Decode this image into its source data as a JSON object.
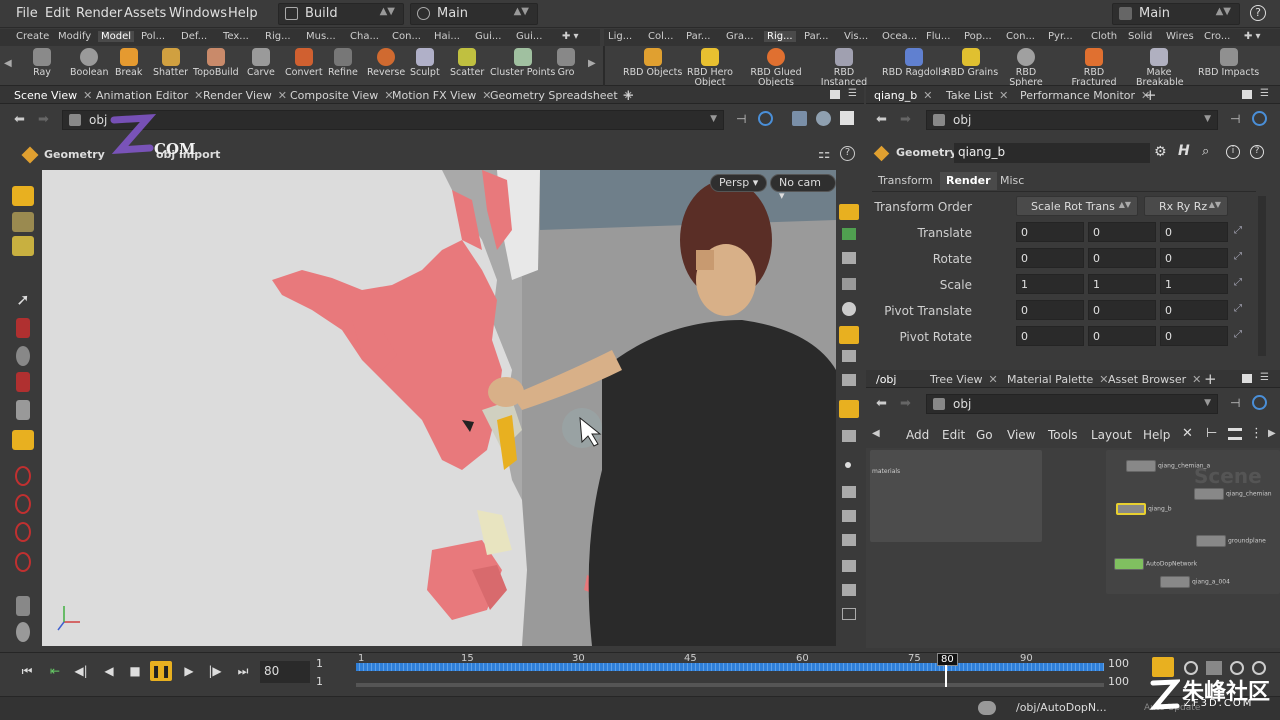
{
  "menu": {
    "items": [
      "File",
      "Edit",
      "Render",
      "Assets",
      "Windows",
      "Help"
    ],
    "desktop": "Build",
    "context": "Main",
    "main_right": "Main"
  },
  "shelf_tabs_left": [
    "Create",
    "Modify",
    "Model",
    "Pol...",
    "Def...",
    "Tex...",
    "Rig...",
    "Mus...",
    "Cha...",
    "Con...",
    "Hai...",
    "Gui...",
    "Gui..."
  ],
  "shelf_tabs_right": [
    "Lig...",
    "Col...",
    "Par...",
    "Gra...",
    "Rig...",
    "Par...",
    "Vis...",
    "Ocea...",
    "Flu...",
    "Pop...",
    "Con...",
    "Pyr...",
    "Cloth",
    "Solid",
    "Wires",
    "Cro..."
  ],
  "shelf_tools_left": [
    "Ray",
    "Boolean",
    "Break",
    "Shatter",
    "TopoBuild",
    "Carve",
    "Convert",
    "Refine",
    "Reverse",
    "Sculpt",
    "Scatter",
    "Cluster Points",
    "Gro"
  ],
  "shelf_tools_right": [
    "RBD Objects",
    "RBD Hero Object",
    "RBD Glued Objects",
    "RBD Instanced Objects",
    "RBD Ragdolls",
    "RBD Grains",
    "RBD Sphere Objects",
    "RBD Fractured Object",
    "Make Breakable",
    "RBD Impacts"
  ],
  "left_pane": {
    "tabs": [
      "Scene View",
      "Animation Editor",
      "Render View",
      "Composite View",
      "Motion FX View",
      "Geometry Spreadsheet"
    ],
    "path": "obj",
    "context_label": "Geometry",
    "node_label": "obj import",
    "persp": "Persp",
    "cam": "No cam"
  },
  "param_pane": {
    "tabs": [
      "qiang_b",
      "Take List",
      "Performance Monitor"
    ],
    "path": "obj",
    "type_label": "Geometry",
    "node_name": "qiang_b",
    "sub_tabs": [
      "Transform",
      "Render",
      "Misc"
    ],
    "active_sub_tab": "Render",
    "transform_order_label": "Transform Order",
    "transform_order": "Scale Rot Trans",
    "rot_order": "Rx Ry Rz",
    "rows": [
      {
        "label": "Translate",
        "values": [
          "0",
          "0",
          "0"
        ]
      },
      {
        "label": "Rotate",
        "values": [
          "0",
          "0",
          "0"
        ]
      },
      {
        "label": "Scale",
        "values": [
          "1",
          "1",
          "1"
        ]
      },
      {
        "label": "Pivot Translate",
        "values": [
          "0",
          "0",
          "0"
        ]
      },
      {
        "label": "Pivot Rotate",
        "values": [
          "0",
          "0",
          "0"
        ]
      }
    ]
  },
  "network_pane": {
    "tabs": [
      "/obj",
      "Tree View",
      "Material Palette",
      "Asset Browser"
    ],
    "path": "obj",
    "menu": [
      "Add",
      "Edit",
      "Go",
      "View",
      "Tools",
      "Layout",
      "Help"
    ],
    "materials_label": "materials",
    "watermark": "Scene",
    "nodes": [
      "qiang_chemian_a",
      "qiang_chemian",
      "qiang_b",
      "groundplane",
      "AutoDopNetwork",
      "qiang_a_004"
    ]
  },
  "timeline": {
    "current_frame": "80",
    "start": "1",
    "start2": "1",
    "end": "100",
    "end2": "100",
    "ticks": [
      "1",
      "15",
      "30",
      "45",
      "60",
      "75",
      "80",
      "90"
    ]
  },
  "status": {
    "path": "/obj/AutoDopN...",
    "extra": "Auto Update"
  },
  "watermark": {
    "logo_text": "COM",
    "site": "朱峰社区",
    "site_sub": "ZF3D.COM"
  },
  "colors": {
    "accent_blue": "#2f7fd8",
    "highlight_yellow": "#e8b020",
    "debris_pink": "#e8797c"
  }
}
